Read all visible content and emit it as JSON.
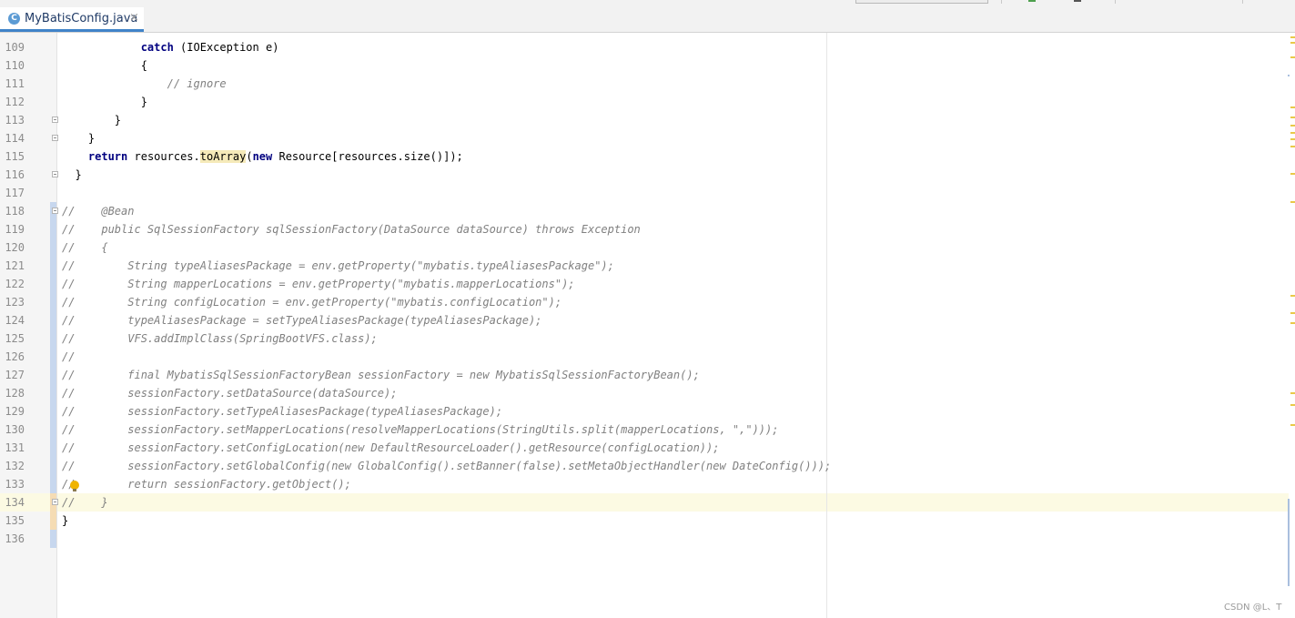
{
  "tab": {
    "icon_letter": "C",
    "file_name": "MyBatisConfig.java",
    "close_glyph": "×"
  },
  "icons": {
    "file_type": "java-class-icon",
    "close": "close-icon",
    "intention": "lightbulb-icon"
  },
  "colors": {
    "keyword": "#000080",
    "comment": "#808080",
    "method_highlight": "#f5eab9",
    "current_line": "#fcfae3",
    "tab_accent": "#4083c9"
  },
  "editor": {
    "current_line": "134",
    "lines": [
      {
        "num": "109",
        "text": "            catch (IOException e)"
      },
      {
        "num": "110",
        "text": "            {"
      },
      {
        "num": "111",
        "text": "                // ignore"
      },
      {
        "num": "112",
        "text": "            }"
      },
      {
        "num": "113",
        "text": "        }"
      },
      {
        "num": "114",
        "text": "    }"
      },
      {
        "num": "115",
        "pre": "    ",
        "kw": "return",
        "mid": " resources.",
        "hl": "toArray",
        "mid2": "(",
        "kw2": "new",
        "post": " Resource[resources.size()]);"
      },
      {
        "num": "116",
        "text": "  }"
      },
      {
        "num": "117",
        "text": ""
      },
      {
        "num": "118",
        "text": "//    @Bean"
      },
      {
        "num": "119",
        "text": "//    public SqlSessionFactory sqlSessionFactory(DataSource dataSource) throws Exception"
      },
      {
        "num": "120",
        "text": "//    {"
      },
      {
        "num": "121",
        "text": "//        String typeAliasesPackage = env.getProperty(\"mybatis.typeAliasesPackage\");"
      },
      {
        "num": "122",
        "text": "//        String mapperLocations = env.getProperty(\"mybatis.mapperLocations\");"
      },
      {
        "num": "123",
        "text": "//        String configLocation = env.getProperty(\"mybatis.configLocation\");"
      },
      {
        "num": "124",
        "text": "//        typeAliasesPackage = setTypeAliasesPackage(typeAliasesPackage);"
      },
      {
        "num": "125",
        "text": "//        VFS.addImplClass(SpringBootVFS.class);"
      },
      {
        "num": "126",
        "text": "//"
      },
      {
        "num": "127",
        "text": "//        final MybatisSqlSessionFactoryBean sessionFactory = new MybatisSqlSessionFactoryBean();"
      },
      {
        "num": "128",
        "text": "//        sessionFactory.setDataSource(dataSource);"
      },
      {
        "num": "129",
        "text": "//        sessionFactory.setTypeAliasesPackage(typeAliasesPackage);"
      },
      {
        "num": "130",
        "text": "//        sessionFactory.setMapperLocations(resolveMapperLocations(StringUtils.split(mapperLocations, \",\")));"
      },
      {
        "num": "131",
        "text": "//        sessionFactory.setConfigLocation(new DefaultResourceLoader().getResource(configLocation));"
      },
      {
        "num": "132",
        "text": "//        sessionFactory.setGlobalConfig(new GlobalConfig().setBanner(false).setMetaObjectHandler(new DateConfig()));"
      },
      {
        "num": "133",
        "text": "//        return sessionFactory.getObject();"
      },
      {
        "num": "134",
        "text": "//    }"
      },
      {
        "num": "135",
        "text": "}"
      },
      {
        "num": "136",
        "text": ""
      }
    ]
  },
  "watermark": "CSDN @L、T"
}
